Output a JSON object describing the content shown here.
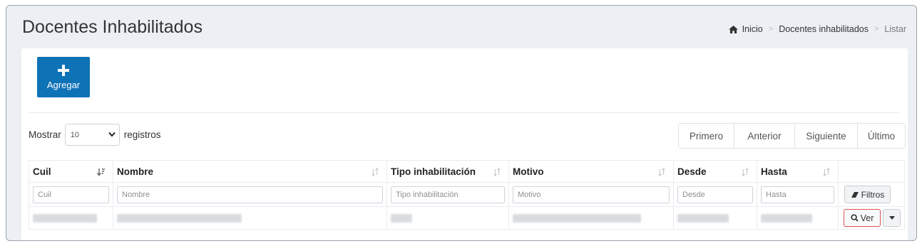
{
  "header": {
    "title": "Docentes Inhabilitados",
    "breadcrumb": {
      "home": "Inicio",
      "section": "Docentes inhabilitados",
      "current": "Listar"
    }
  },
  "toolbar": {
    "add_label": "Agregar"
  },
  "length_menu": {
    "prefix": "Mostrar",
    "selected": "10",
    "suffix": "registros"
  },
  "pagination": {
    "first": "Primero",
    "previous": "Anterior",
    "next": "Siguiente",
    "last": "Último"
  },
  "table": {
    "columns": [
      "Cuil",
      "Nombre",
      "Tipo inhabilitación",
      "Motivo",
      "Desde",
      "Hasta"
    ],
    "filters": [
      "Cuil",
      "Nombre",
      "Tipo inhabilitación",
      "Motivo",
      "Desde",
      "Hasta"
    ],
    "filter_button": "Filtros",
    "row_action": "Ver"
  },
  "colors": {
    "primary": "#0e72b6",
    "highlight": "#e05252"
  }
}
